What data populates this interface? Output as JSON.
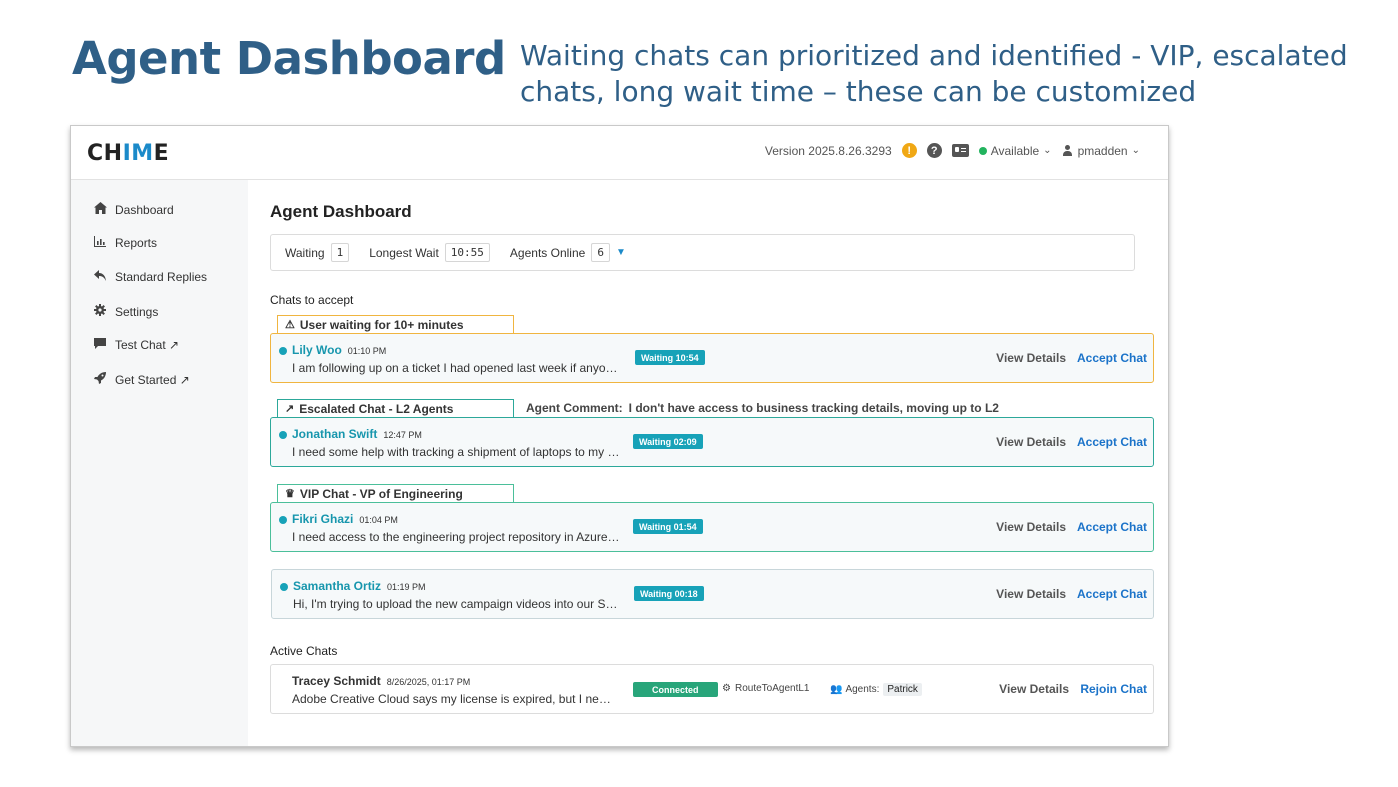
{
  "slide": {
    "title": "Agent Dashboard",
    "subtitle": "Waiting chats can prioritized and identified  - VIP, escalated chats, long wait time – these can be customized"
  },
  "topbar": {
    "logo_a": "CH",
    "logo_b": "IM",
    "logo_c": "E",
    "version": "Version 2025.8.26.3293",
    "status": "Available",
    "user": "pmadden"
  },
  "sidebar": {
    "items": [
      {
        "label": "Dashboard",
        "icon": "home-icon"
      },
      {
        "label": "Reports",
        "icon": "bar-chart-icon"
      },
      {
        "label": "Standard Replies",
        "icon": "reply-icon"
      },
      {
        "label": "Settings",
        "icon": "gear-icon"
      },
      {
        "label": "Test Chat ↗",
        "icon": "comment-icon"
      },
      {
        "label": "Get Started ↗",
        "icon": "rocket-icon"
      }
    ]
  },
  "main": {
    "title": "Agent Dashboard",
    "stats": {
      "waiting_label": "Waiting",
      "waiting_value": "1",
      "longest_label": "Longest Wait",
      "longest_value": "10:55",
      "agents_label": "Agents Online",
      "agents_value": "6"
    },
    "chats_to_accept_label": "Chats to accept",
    "active_chats_label": "Active Chats",
    "tags": {
      "long_wait": "User waiting for 10+ minutes",
      "escalated": "Escalated Chat - L2 Agents",
      "vip": "VIP Chat - VP of Engineering"
    },
    "agent_comment_label": "Agent Comment:",
    "agent_comment_text": "I don't have access to business tracking details, moving up to L2",
    "pending_chats": [
      {
        "name": "Lily Woo",
        "time": "01:10 PM",
        "message": "I am following up on a ticket I had opened last week if anyone can help",
        "badge": "Waiting 10:54",
        "details": "View Details",
        "action": "Accept Chat"
      },
      {
        "name": "Jonathan Swift",
        "time": "12:47 PM",
        "message": "I need some help with tracking a shipment of laptops to my office",
        "badge": "Waiting 02:09",
        "details": "View Details",
        "action": "Accept Chat"
      },
      {
        "name": "Fikri Ghazi",
        "time": "01:04 PM",
        "message": "I need access to the engineering project repository in Azure DevOps",
        "badge": "Waiting 01:54",
        "details": "View Details",
        "action": "Accept Chat"
      },
      {
        "name": "Samantha Ortiz",
        "time": "01:19 PM",
        "message": "Hi, I'm trying to upload the new campaign videos into our SharePoint",
        "badge": "Waiting 00:18",
        "details": "View Details",
        "action": "Accept Chat"
      }
    ],
    "active_chat": {
      "name": "Tracey Schmidt",
      "time": "8/26/2025, 01:17 PM",
      "message": "Adobe Creative Cloud says my license is expired, but I need it today",
      "badge": "Connected",
      "route": "RouteToAgentL1",
      "agents_label": "Agents:",
      "agent": "Patrick",
      "details": "View Details",
      "action": "Rejoin Chat"
    }
  },
  "colors": {
    "slide_text": "#2f5f87",
    "accent": "#1b8ac9",
    "wait_badge": "#17a2b8",
    "connected": "#28a57a",
    "long_wait_border": "#f0b540",
    "escalated_border": "#2ca89a",
    "vip_border": "#4bbf9a",
    "default_border": "#c8d6da"
  }
}
